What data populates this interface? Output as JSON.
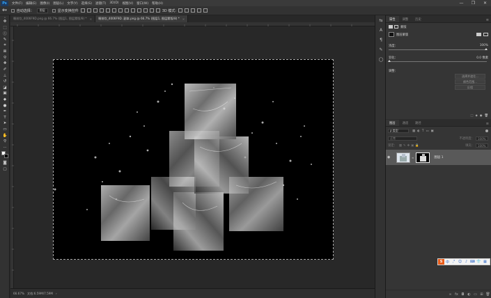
{
  "menu": {
    "logo": "Ps",
    "items": [
      "文件(F)",
      "编辑(E)",
      "图像(I)",
      "图层(L)",
      "文字(Y)",
      "选择(S)",
      "滤镜(T)",
      "3D(D)",
      "视图(V)",
      "窗口(W)",
      "帮助(H)"
    ],
    "window_controls": [
      "—",
      "❐",
      "✕"
    ]
  },
  "options": {
    "auto_select_label": "自动选择：",
    "auto_select_value": "图层",
    "show_transform_label": "显示变换控件"
  },
  "tabs": [
    {
      "label": "睡前饮_4006F9D.png @ 66.7% (图层1, 图层蒙版/8) *",
      "active": false
    },
    {
      "label": "睡前饮_4006F9D. 副本.png @ 66.7% (图层1, 图层蒙版/8) *",
      "active": true
    }
  ],
  "status": {
    "zoom": "66.67%",
    "doc_info": "文档:6.59M/7.59M"
  },
  "properties": {
    "tabs": [
      "属性",
      "调整",
      "历史"
    ],
    "mask_label": "蒙版",
    "layer_mask_label": "图层蒙版",
    "density_label": "浓度：",
    "density_value": "100%",
    "feather_label": "羽化：",
    "feather_value": "0.0 像素",
    "refine_label": "调整：",
    "btn_select_mask": "选择并遮住...",
    "btn_color_range": "颜色范围...",
    "btn_invert": "反相"
  },
  "layers": {
    "tabs": [
      "图层",
      "通道",
      "路径"
    ],
    "filter_kind": "ρ 类型",
    "blend_mode": "正常",
    "opacity_label": "不透明度：",
    "opacity_value": "100%",
    "lock_label": "锁定：",
    "fill_label": "填充：",
    "fill_value": "100%",
    "items": [
      {
        "name": "图层 1",
        "visible": true
      }
    ]
  },
  "tools": [
    "move-icon",
    "marquee-icon",
    "lasso-icon",
    "quick-select-icon",
    "crop-icon",
    "eyedropper-icon",
    "healing-icon",
    "brush-icon",
    "stamp-icon",
    "history-brush-icon",
    "eraser-icon",
    "gradient-icon",
    "blur-icon",
    "dodge-icon",
    "pen-icon",
    "type-icon",
    "path-select-icon",
    "rectangle-icon",
    "hand-icon",
    "zoom-icon",
    "more-icon"
  ],
  "ime": {
    "label": "S"
  }
}
